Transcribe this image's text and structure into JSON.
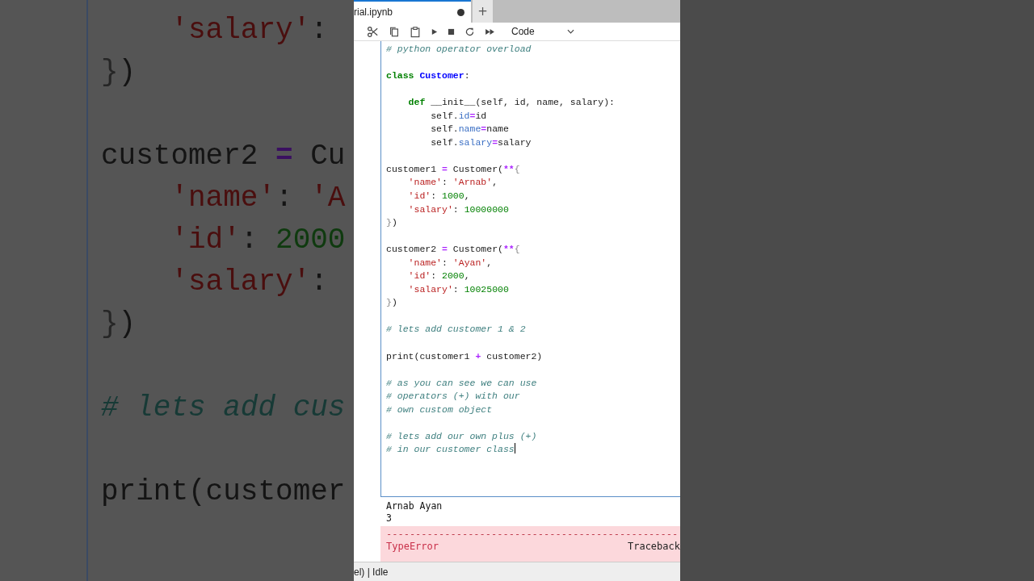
{
  "backdrop": {
    "lines": [
      {
        "kind": "code",
        "segments": [
          {
            "t": "    'salary'",
            "kind": "str"
          },
          {
            "t": ":",
            "kind": "plain"
          }
        ]
      },
      {
        "kind": "code",
        "segments": [
          {
            "t": "}",
            "kind": "brace"
          },
          {
            "t": ")",
            "kind": "plain"
          }
        ]
      },
      {
        "kind": "blank"
      },
      {
        "kind": "code",
        "segments": [
          {
            "t": "customer2 ",
            "kind": "plain"
          },
          {
            "t": "=",
            "kind": "op"
          },
          {
            "t": " Cu",
            "kind": "plain"
          }
        ]
      },
      {
        "kind": "code",
        "segments": [
          {
            "t": "    'name'",
            "kind": "str"
          },
          {
            "t": ": ",
            "kind": "plain"
          },
          {
            "t": "'A",
            "kind": "str"
          }
        ]
      },
      {
        "kind": "code",
        "segments": [
          {
            "t": "    'id'",
            "kind": "str"
          },
          {
            "t": ": ",
            "kind": "plain"
          },
          {
            "t": "2000",
            "kind": "num"
          }
        ]
      },
      {
        "kind": "code",
        "segments": [
          {
            "t": "    'salary'",
            "kind": "str"
          },
          {
            "t": ":",
            "kind": "plain"
          }
        ]
      },
      {
        "kind": "code",
        "segments": [
          {
            "t": "}",
            "kind": "brace"
          },
          {
            "t": ")",
            "kind": "plain"
          }
        ]
      },
      {
        "kind": "blank"
      },
      {
        "kind": "code",
        "segments": [
          {
            "t": "# lets add cus",
            "kind": "comment"
          }
        ]
      },
      {
        "kind": "blank"
      },
      {
        "kind": "code",
        "segments": [
          {
            "t": "print(customer",
            "kind": "plain"
          }
        ]
      }
    ]
  },
  "tab": {
    "title": "rial.ipynb",
    "modified": true,
    "new_tab": "+"
  },
  "toolbar": {
    "cell_type": "Code"
  },
  "cell": {
    "lines": [
      {
        "kind": "code",
        "segments": [
          {
            "t": "# python operator overload",
            "kind": "comment"
          }
        ]
      },
      {
        "kind": "blank"
      },
      {
        "kind": "code",
        "segments": [
          {
            "t": "class",
            "kind": "kw"
          },
          {
            "t": " Customer",
            "kind": "classname"
          },
          {
            "t": ":",
            "kind": "plain"
          }
        ]
      },
      {
        "kind": "blank"
      },
      {
        "kind": "code",
        "segments": [
          {
            "t": "    def",
            "kind": "kw"
          },
          {
            "t": " __init__(self, id, name, salary):",
            "kind": "plain"
          }
        ]
      },
      {
        "kind": "code",
        "segments": [
          {
            "t": "        self.",
            "kind": "plain"
          },
          {
            "t": "id",
            "kind": "attr"
          },
          {
            "t": "=",
            "kind": "op"
          },
          {
            "t": "id",
            "kind": "plain"
          }
        ]
      },
      {
        "kind": "code",
        "segments": [
          {
            "t": "        self.",
            "kind": "plain"
          },
          {
            "t": "name",
            "kind": "attr"
          },
          {
            "t": "=",
            "kind": "op"
          },
          {
            "t": "name",
            "kind": "plain"
          }
        ]
      },
      {
        "kind": "code",
        "segments": [
          {
            "t": "        self.",
            "kind": "plain"
          },
          {
            "t": "salary",
            "kind": "attr"
          },
          {
            "t": "=",
            "kind": "op"
          },
          {
            "t": "salary",
            "kind": "plain"
          }
        ]
      },
      {
        "kind": "blank"
      },
      {
        "kind": "code",
        "segments": [
          {
            "t": "customer1 ",
            "kind": "plain"
          },
          {
            "t": "=",
            "kind": "op"
          },
          {
            "t": " Customer(",
            "kind": "plain"
          },
          {
            "t": "**",
            "kind": "op"
          },
          {
            "t": "{",
            "kind": "brace"
          }
        ]
      },
      {
        "kind": "code",
        "segments": [
          {
            "t": "    'name'",
            "kind": "str"
          },
          {
            "t": ": ",
            "kind": "plain"
          },
          {
            "t": "'Arnab'",
            "kind": "str"
          },
          {
            "t": ",",
            "kind": "plain"
          }
        ]
      },
      {
        "kind": "code",
        "segments": [
          {
            "t": "    'id'",
            "kind": "str"
          },
          {
            "t": ": ",
            "kind": "plain"
          },
          {
            "t": "1000",
            "kind": "num"
          },
          {
            "t": ",",
            "kind": "plain"
          }
        ]
      },
      {
        "kind": "code",
        "segments": [
          {
            "t": "    'salary'",
            "kind": "str"
          },
          {
            "t": ": ",
            "kind": "plain"
          },
          {
            "t": "10000000",
            "kind": "num"
          }
        ]
      },
      {
        "kind": "code",
        "segments": [
          {
            "t": "}",
            "kind": "brace"
          },
          {
            "t": ")",
            "kind": "plain"
          }
        ]
      },
      {
        "kind": "blank"
      },
      {
        "kind": "code",
        "segments": [
          {
            "t": "customer2 ",
            "kind": "plain"
          },
          {
            "t": "=",
            "kind": "op"
          },
          {
            "t": " Customer(",
            "kind": "plain"
          },
          {
            "t": "**",
            "kind": "op"
          },
          {
            "t": "{",
            "kind": "brace"
          }
        ]
      },
      {
        "kind": "code",
        "segments": [
          {
            "t": "    'name'",
            "kind": "str"
          },
          {
            "t": ": ",
            "kind": "plain"
          },
          {
            "t": "'Ayan'",
            "kind": "str"
          },
          {
            "t": ",",
            "kind": "plain"
          }
        ]
      },
      {
        "kind": "code",
        "segments": [
          {
            "t": "    'id'",
            "kind": "str"
          },
          {
            "t": ": ",
            "kind": "plain"
          },
          {
            "t": "2000",
            "kind": "num"
          },
          {
            "t": ",",
            "kind": "plain"
          }
        ]
      },
      {
        "kind": "code",
        "segments": [
          {
            "t": "    'salary'",
            "kind": "str"
          },
          {
            "t": ": ",
            "kind": "plain"
          },
          {
            "t": "10025000",
            "kind": "num"
          }
        ]
      },
      {
        "kind": "code",
        "segments": [
          {
            "t": "}",
            "kind": "brace"
          },
          {
            "t": ")",
            "kind": "plain"
          }
        ]
      },
      {
        "kind": "blank"
      },
      {
        "kind": "code",
        "segments": [
          {
            "t": "# lets add customer 1 & 2",
            "kind": "comment"
          }
        ]
      },
      {
        "kind": "blank"
      },
      {
        "kind": "code",
        "segments": [
          {
            "t": "print(customer1 ",
            "kind": "plain"
          },
          {
            "t": "+",
            "kind": "op"
          },
          {
            "t": " customer2)",
            "kind": "plain"
          }
        ]
      },
      {
        "kind": "blank"
      },
      {
        "kind": "code",
        "segments": [
          {
            "t": "# as you can see we can use",
            "kind": "comment"
          }
        ]
      },
      {
        "kind": "code",
        "segments": [
          {
            "t": "# operators (+) with our",
            "kind": "comment"
          }
        ]
      },
      {
        "kind": "code",
        "segments": [
          {
            "t": "# own custom object",
            "kind": "comment"
          }
        ]
      },
      {
        "kind": "blank"
      },
      {
        "kind": "code",
        "segments": [
          {
            "t": "# lets add our own plus (+)",
            "kind": "comment"
          }
        ]
      },
      {
        "kind": "code",
        "cursor": true,
        "segments": [
          {
            "t": "# in our customer class",
            "kind": "comment"
          }
        ]
      }
    ]
  },
  "output": {
    "lines": [
      "Arnab Ayan",
      "3"
    ],
    "error": {
      "rule": "--------------------------------------------------",
      "name": "TypeError",
      "label": "Traceback"
    }
  },
  "status_bar": "el) | Idle"
}
